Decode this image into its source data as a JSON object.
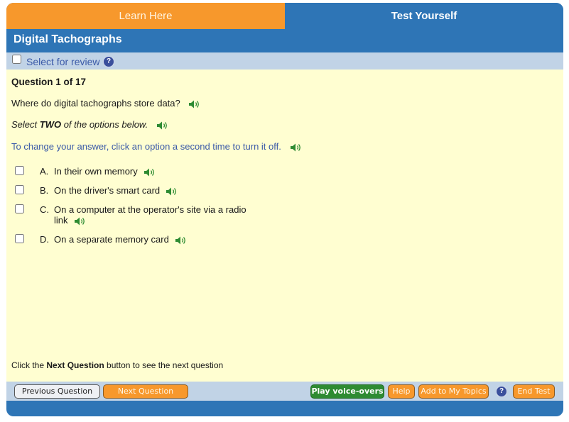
{
  "tabs": [
    {
      "label": "Learn Here",
      "active": false
    },
    {
      "label": "Test Yourself",
      "active": true
    }
  ],
  "header": {
    "title": "Digital Tachographs"
  },
  "review": {
    "label": "Select for review",
    "checked": false,
    "help_icon": "?"
  },
  "question": {
    "number_label": "Question 1 of 17",
    "text": "Where do digital tachographs store data?",
    "instruction_prefix": "Select ",
    "instruction_bold": "TWO",
    "instruction_suffix": " of the options below.",
    "change_hint": "To change your answer, click an option a second time to turn it off.",
    "options": [
      {
        "letter": "A.",
        "text": "In their own memory",
        "checked": false
      },
      {
        "letter": "B.",
        "text": "On the driver's smart card",
        "checked": false
      },
      {
        "letter": "C.",
        "text": "On a computer at the operator's site via a radio link",
        "checked": false
      },
      {
        "letter": "D.",
        "text": "On a separate memory card",
        "checked": false
      }
    ]
  },
  "next_hint": {
    "prefix": "Click the ",
    "bold": "Next Question",
    "suffix": " button to see the next question"
  },
  "footer": {
    "previous_label": "Previous Question",
    "next_label": "Next Question",
    "play_label": "Play voice-overs",
    "help_label": "Help",
    "add_topics_label": "Add to My Topics",
    "help_icon": "?",
    "end_label": "End Test"
  },
  "colors": {
    "brand_blue": "#2e75b6",
    "orange": "#f7982c",
    "green": "#2e8b32",
    "content_bg": "#fffed1",
    "bar_bg": "#c1d3e6"
  }
}
